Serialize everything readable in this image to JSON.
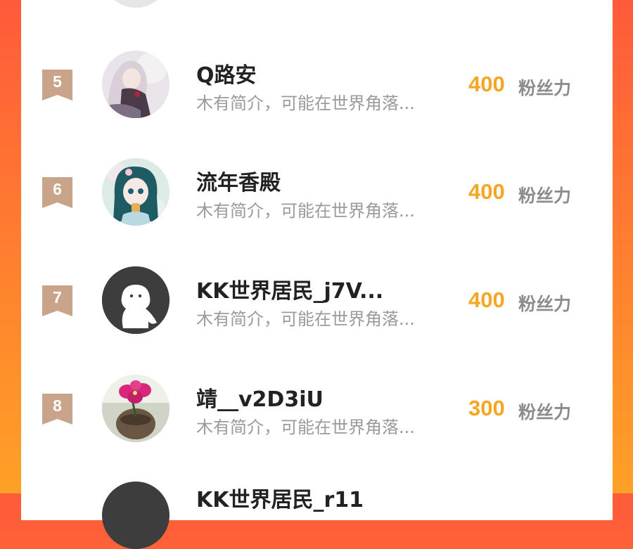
{
  "leaderboard": {
    "entries": [
      {
        "rank": "5",
        "name": "Q路安",
        "bio": "木有简介，可能在世界角落...",
        "fans_value": "400",
        "fans_unit": "粉丝力",
        "avatar": "anime-girl-white-hair"
      },
      {
        "rank": "6",
        "name": "流年香殿",
        "bio": "木有简介，可能在世界角落...",
        "fans_value": "400",
        "fans_unit": "粉丝力",
        "avatar": "anime-girl-green-hair"
      },
      {
        "rank": "7",
        "name": "KK世界居民_j7V...",
        "bio": "木有简介，可能在世界角落...",
        "fans_value": "400",
        "fans_unit": "粉丝力",
        "avatar": "default-ghost-avatar"
      },
      {
        "rank": "8",
        "name": "靖__v2D3iU",
        "bio": "木有简介，可能在世界角落...",
        "fans_value": "300",
        "fans_unit": "粉丝力",
        "avatar": "orchid-flower-photo"
      }
    ],
    "partial_next_name": "KK世界居民_r11"
  },
  "colors": {
    "background_top": "#ff5a3a",
    "background_bottom": "#ffa126",
    "fans_value": "#f5a623",
    "badge": "#c9a48a"
  }
}
